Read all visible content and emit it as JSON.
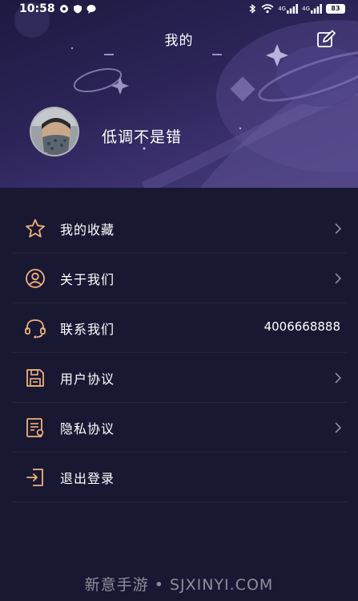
{
  "status_bar": {
    "time": "10:58",
    "battery": "83",
    "signal_label_1": "4G",
    "signal_label_2": "4G"
  },
  "header": {
    "title": "我的",
    "username": "低调不是错"
  },
  "menu": {
    "items": [
      {
        "label": "我的收藏",
        "icon": "star-icon"
      },
      {
        "label": "关于我们",
        "icon": "user-circle-icon"
      },
      {
        "label": "联系我们",
        "icon": "headset-icon",
        "value": "4006668888"
      },
      {
        "label": "用户协议",
        "icon": "floppy-disk-icon"
      },
      {
        "label": "隐私协议",
        "icon": "document-icon"
      },
      {
        "label": "退出登录",
        "icon": "logout-icon"
      }
    ]
  },
  "watermark": "新意手游 • SJXINYI.COM",
  "colors": {
    "background": "#191832",
    "icon_accent": "#f0b27a",
    "divider": "#262542"
  }
}
